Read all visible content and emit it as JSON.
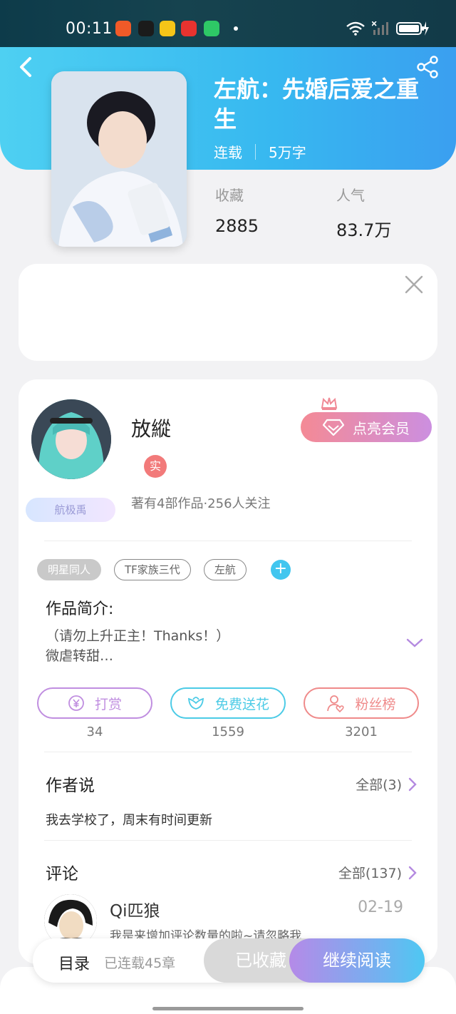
{
  "status_bar": {
    "time": "00:11",
    "app_icons": [
      {
        "name": "app-icon-orange",
        "color": "#f05a28"
      },
      {
        "name": "tiktok-icon",
        "color": "#1b1b1b"
      },
      {
        "name": "app-icon-yellow",
        "color": "#f5c518"
      },
      {
        "name": "app-icon-red",
        "color": "#e8332f"
      },
      {
        "name": "app-icon-green",
        "color": "#2ec866"
      }
    ]
  },
  "book": {
    "title": "左航：先婚后爱之重生",
    "status": "连载",
    "word_count": "5万字",
    "stats": [
      {
        "label": "收藏",
        "value": "2885"
      },
      {
        "label": "人气",
        "value": "83.7万"
      }
    ]
  },
  "author": {
    "name": "放縱",
    "real_badge": "实",
    "fan_badge": "航极禹",
    "stats": "著有4部作品·256人关注",
    "vip_label": "点亮会员"
  },
  "tags": [
    "明星同人",
    "TF家族三代",
    "左航"
  ],
  "intro": {
    "title": "作品简介:",
    "line1": "（请勿上升正主！Thanks！）",
    "line2": "微虐转甜…"
  },
  "actions": [
    {
      "label": "打赏",
      "count": "34",
      "color": "#c08ee0"
    },
    {
      "label": "免费送花",
      "count": "1559",
      "color": "#4ccbe6"
    },
    {
      "label": "粉丝榜",
      "count": "3201",
      "color": "#ef8a8a"
    }
  ],
  "author_says": {
    "title": "作者说",
    "more": "全部(3)",
    "text": "我去学校了，周末有时间更新"
  },
  "comments": {
    "title": "评论",
    "more": "全部(137)",
    "items": [
      {
        "user": "Qi匹狼",
        "date": "02-19",
        "text": "我是来增加评论数量的啦~请忽略我"
      }
    ]
  },
  "bottom": {
    "toc": "目录",
    "chapters": "已连载45章",
    "favorited": "已收藏",
    "continue": "继续阅读"
  }
}
